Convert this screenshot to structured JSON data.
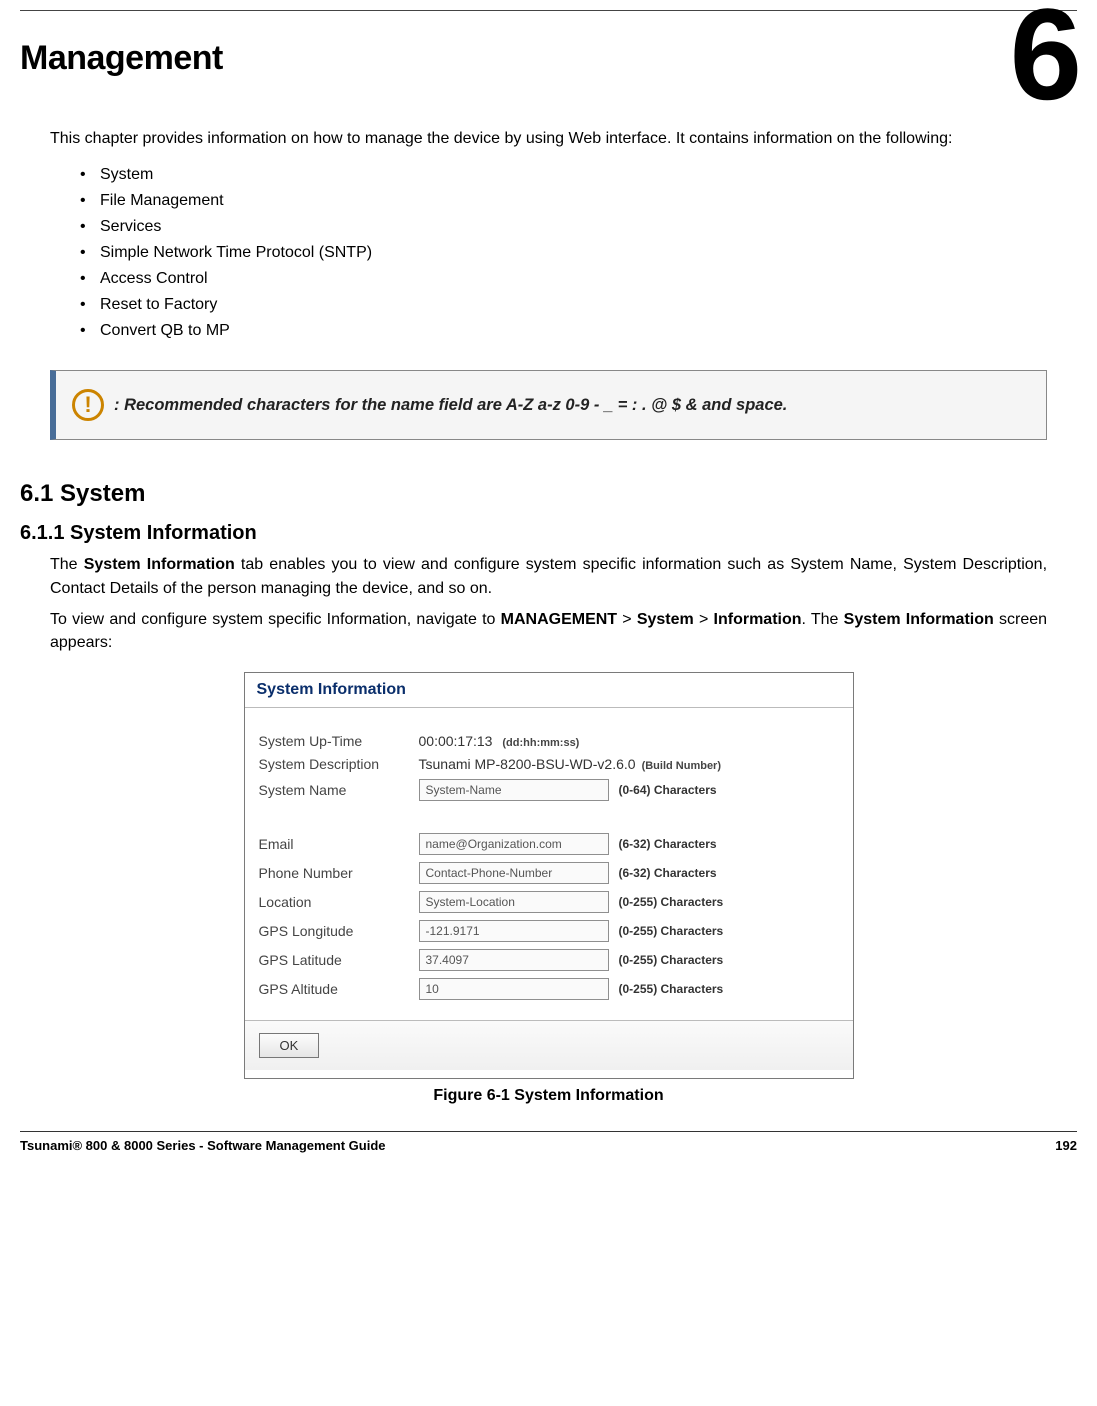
{
  "chapter_number": "6",
  "title": "Management",
  "intro": "This chapter provides information on how to manage the device by using Web interface. It contains information on the following:",
  "toc": [
    "System",
    "File Management",
    "Services",
    "Simple Network Time Protocol (SNTP)",
    "Access Control",
    "Reset to Factory",
    "Convert QB to MP"
  ],
  "callout_text": ": Recommended characters for the name field are A-Z  a-z  0-9  - _ = :  . @ $ & and space.",
  "sec_heading": "6.1 System",
  "sub_heading": "6.1.1 System Information",
  "para1_pre": "The ",
  "para1_bold1": "System Information",
  "para1_post": " tab enables you to view and configure system specific information such as System Name, System Description, Contact Details of the person managing the device, and so on.",
  "para2_pre": "To view and configure system specific Information, navigate to ",
  "para2_nav_mgmt": "MANAGEMENT",
  "para2_gt1": " > ",
  "para2_nav_sys": "System",
  "para2_gt2": " > ",
  "para2_nav_info": "Information",
  "para2_mid": ". The ",
  "para2_bold_end": "System Information",
  "para2_post": " screen appears:",
  "shot": {
    "title": "System Information",
    "rows": {
      "uptime_label": "System Up-Time",
      "uptime_value": "00:00:17:13",
      "uptime_suffix": "(dd:hh:mm:ss)",
      "desc_label": "System Description",
      "desc_value": "Tsunami MP-8200-BSU-WD-v2.6.0",
      "desc_suffix": "(Build Number)",
      "name_label": "System Name",
      "name_value": "System-Name",
      "name_hint": "(0-64) Characters",
      "email_label": "Email",
      "email_value": "name@Organization.com",
      "email_hint": "(6-32) Characters",
      "phone_label": "Phone Number",
      "phone_value": "Contact-Phone-Number",
      "phone_hint": "(6-32) Characters",
      "loc_label": "Location",
      "loc_value": "System-Location",
      "loc_hint": "(0-255) Characters",
      "lon_label": "GPS Longitude",
      "lon_value": "-121.9171",
      "lon_hint": "(0-255) Characters",
      "lat_label": "GPS Latitude",
      "lat_value": "37.4097",
      "lat_hint": "(0-255) Characters",
      "alt_label": "GPS Altitude",
      "alt_value": "10",
      "alt_hint": "(0-255) Characters"
    },
    "ok_label": "OK"
  },
  "figure_caption": "Figure 6-1 System Information",
  "footer_left": "Tsunami® 800 & 8000 Series - Software Management Guide",
  "footer_right": "192"
}
